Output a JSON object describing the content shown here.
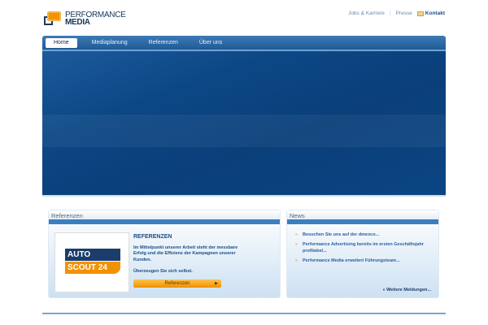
{
  "logo": {
    "line1": "PERFORMANCE",
    "line2": "MEDIA"
  },
  "toplinks": {
    "jobs": "Jobs & Karriere",
    "sep": "|",
    "presse": "Presse",
    "kontakt": "Kontakt"
  },
  "nav": [
    "Home",
    "Mediaplanung",
    "Referenzen",
    "Über uns"
  ],
  "referenzen": {
    "header": "Referenzen",
    "logo_line1": "AUTO",
    "logo_line2": "SCOUT 24",
    "title": "REFERENZEN",
    "text": "Im Mittelpunkt unserer Arbeit steht der messbare Erfolg und die Effizienz der Kampagnen unserer Kunden.",
    "text2": "Überzeugen Sie sich selbst.",
    "button": "Referenzen",
    "button_arrow": "▶"
  },
  "news": {
    "header": "News",
    "bullet": "»",
    "items": [
      "Besuchen Sie uns auf der dmexco...",
      "Performance Advertising bereits im ersten Geschäftsjahr profitabel...",
      "Performance Media erweitert Führungsteam..."
    ],
    "more": "» Weitere Meldungen..."
  }
}
